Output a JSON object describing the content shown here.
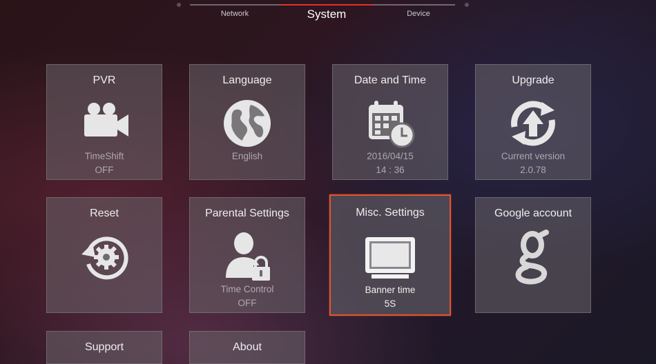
{
  "tabs": [
    {
      "label": "Network",
      "active": false
    },
    {
      "label": "System",
      "active": true
    },
    {
      "label": "Device",
      "active": false
    }
  ],
  "tiles": [
    {
      "title": "PVR",
      "icon": "video-camera-icon",
      "sub1": "TimeShift",
      "sub2": "OFF"
    },
    {
      "title": "Language",
      "icon": "globe-icon",
      "sub1": "English",
      "sub2": ""
    },
    {
      "title": "Date and Time",
      "icon": "calendar-clock-icon",
      "sub1": "2016/04/15",
      "sub2": "14 : 36"
    },
    {
      "title": "Upgrade",
      "icon": "refresh-upload-icon",
      "sub1": "Current version",
      "sub2": "2.0.78"
    },
    {
      "title": "Reset",
      "icon": "reset-gear-icon",
      "sub1": "",
      "sub2": ""
    },
    {
      "title": "Parental Settings",
      "icon": "user-lock-icon",
      "sub1": "Time Control",
      "sub2": "OFF"
    },
    {
      "title": "Misc. Settings",
      "icon": "monitor-icon",
      "sub1": "Banner time",
      "sub2": "5S",
      "focused": true
    },
    {
      "title": "Google account",
      "icon": "google-g-icon",
      "sub1": "",
      "sub2": ""
    },
    {
      "title": "Support",
      "icon": "",
      "sub1": "",
      "sub2": ""
    },
    {
      "title": "About",
      "icon": "",
      "sub1": "",
      "sub2": ""
    }
  ],
  "colors": {
    "accent": "#e0322b",
    "focus_border": "#e4552c"
  }
}
